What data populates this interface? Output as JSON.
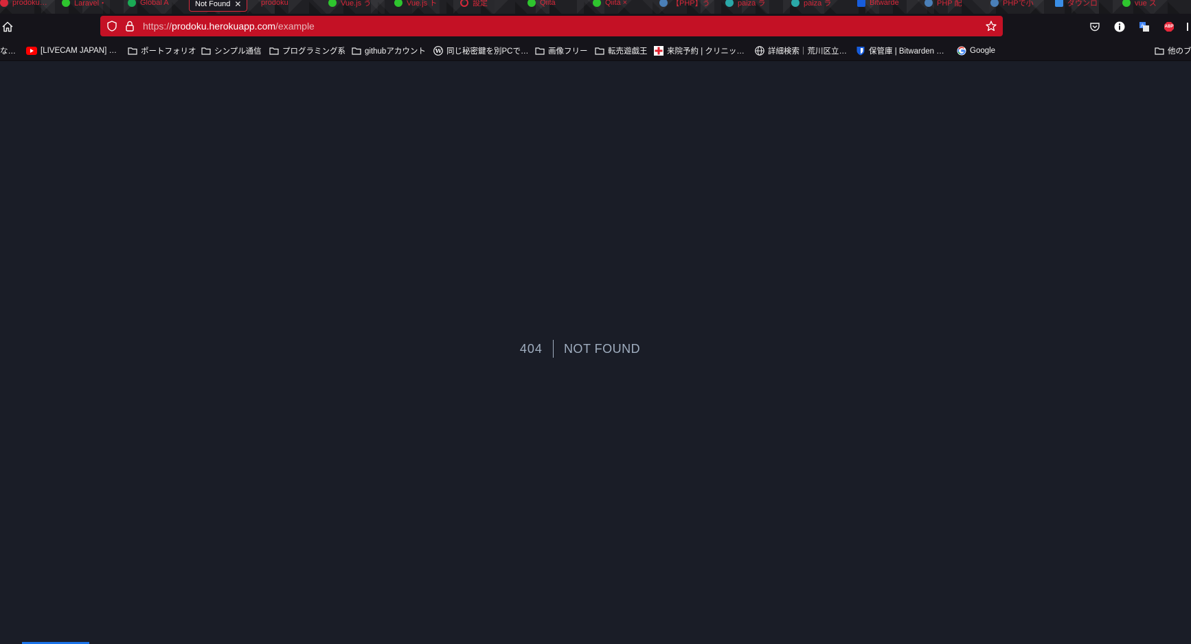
{
  "tabs": [
    {
      "label": "prodoku…",
      "color": "#d8283a"
    },
    {
      "label": "Laravel・",
      "color": "#2ec52e"
    },
    {
      "label": "Global A",
      "color": "#1aaa55"
    },
    {
      "label": "Not Found",
      "active": true
    },
    {
      "label": "prodoku",
      "color": "#d8283a"
    },
    {
      "label": "Vue.js う",
      "color": "#2ec52e"
    },
    {
      "label": "Vue.js ト",
      "color": "#2ec52e"
    },
    {
      "label": "設定",
      "color": "#d8283a"
    },
    {
      "label": "Qiita",
      "color": "#2ec52e"
    },
    {
      "label": "Qiita ×",
      "color": "#2ec52e"
    },
    {
      "label": "【PHP】う",
      "color": "#4a7fb8"
    },
    {
      "label": "paiza ラ",
      "color": "#2aa8a8"
    },
    {
      "label": "paiza ラ",
      "color": "#2aa8a8"
    },
    {
      "label": "Bitwarde",
      "color": "#175ddc"
    },
    {
      "label": "PHP 配",
      "color": "#4a7fb8"
    },
    {
      "label": "PHPで小",
      "color": "#4a7fb8"
    },
    {
      "label": "ダウンロ",
      "color": "#3a8ee6"
    },
    {
      "label": "vue ス",
      "color": "#2ec52e"
    }
  ],
  "toolbar": {
    "url_scheme": "https://",
    "url_host": "prodoku.herokuapp.com",
    "url_path": "/example",
    "extensions": [
      "pocket-icon",
      "info-icon",
      "translate-icon",
      "adblock-icon"
    ],
    "adblock_label": "ABP"
  },
  "bookmarks": [
    {
      "label": "な…",
      "icon": "none"
    },
    {
      "label": "[LIVECAM JAPAN] …",
      "icon": "youtube-icon"
    },
    {
      "label": "ポートフォリオ",
      "icon": "folder-icon"
    },
    {
      "label": "シンプル通信",
      "icon": "folder-icon"
    },
    {
      "label": "プログラミング系",
      "icon": "folder-icon"
    },
    {
      "label": "githubアカウント",
      "icon": "folder-icon"
    },
    {
      "label": "同じ秘密鍵を別PCで…",
      "icon": "wordpress-icon"
    },
    {
      "label": "画像フリー",
      "icon": "folder-icon"
    },
    {
      "label": "転売遊戯王",
      "icon": "folder-icon"
    },
    {
      "label": "来院予約 | クリニッ…",
      "icon": "clinic-icon"
    },
    {
      "label": "詳細検索｜荒川区立…",
      "icon": "globe-icon"
    },
    {
      "label": "保管庫 | Bitwarden …",
      "icon": "bitwarden-icon"
    },
    {
      "label": "Google",
      "icon": "google-icon"
    },
    {
      "label": "他のブ",
      "icon": "folder-icon"
    }
  ],
  "page": {
    "code": "404",
    "message": "Not Found"
  },
  "colors": {
    "url_bar": "#c41125",
    "page_bg": "#1a1d27",
    "text_muted": "#a0aec0"
  }
}
